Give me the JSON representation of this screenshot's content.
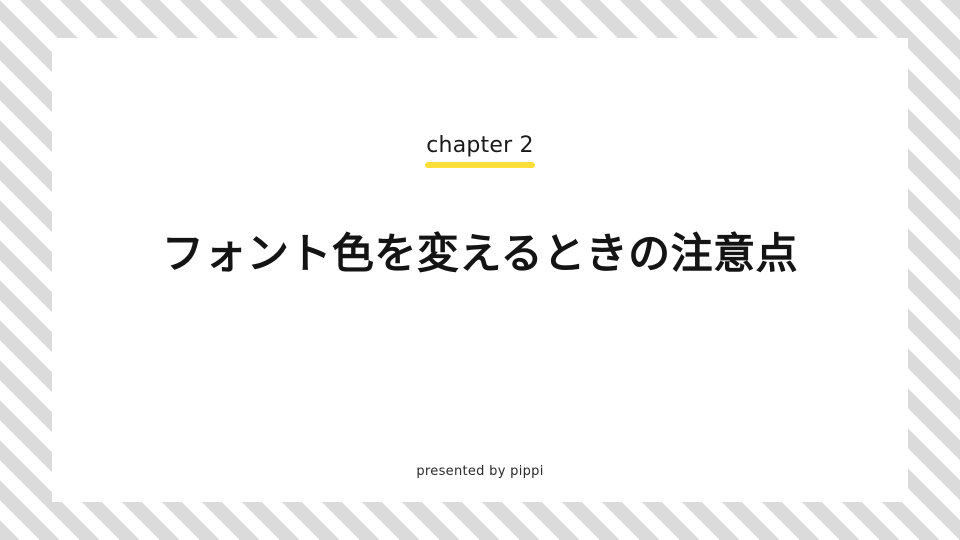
{
  "slide": {
    "background": {
      "base_color": "#ffffff",
      "stripe_color": "#dbdbdb",
      "stripe_angle_deg": 45
    },
    "card": {
      "background_color": "#ffffff"
    },
    "eyebrow": {
      "label": "chapter 2",
      "underline_color": "#ffde3a"
    },
    "title": {
      "text": "フォント色を変えるときの注意点",
      "color": "#141414"
    },
    "footer": {
      "credit": "presented by pippi",
      "color": "#2a2a2a"
    }
  }
}
